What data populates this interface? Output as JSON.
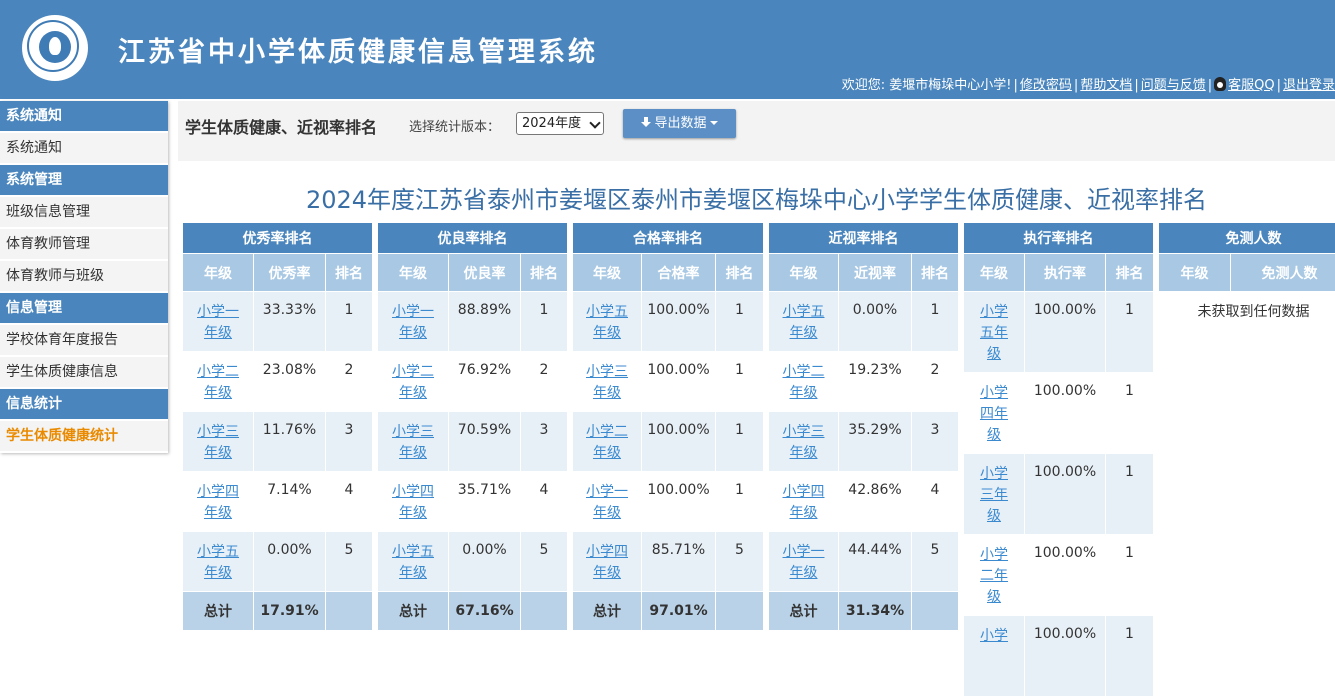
{
  "header": {
    "title": "江苏省中小学体质健康信息管理系统",
    "welcome": "欢迎您: 姜堰市梅垛中心小学!",
    "links": [
      "修改密码",
      "帮助文档",
      "问题与反馈",
      "客服QQ",
      "退出登录"
    ]
  },
  "sidebar": {
    "groups": [
      {
        "title": "系统通知",
        "items": [
          "系统通知"
        ]
      },
      {
        "title": "系统管理",
        "items": [
          "班级信息管理",
          "体育教师管理",
          "体育教师与班级"
        ]
      },
      {
        "title": "信息管理",
        "items": [
          "学校体育年度报告",
          "学生体质健康信息"
        ]
      },
      {
        "title": "信息统计",
        "items": [
          "学生体质健康统计"
        ]
      }
    ]
  },
  "toolbar": {
    "title": "学生体质健康、近视率排名",
    "version_label": "选择统计版本：",
    "version_value": "2024年度",
    "export_label": "导出数据"
  },
  "report_title": "2024年度江苏省泰州市姜堰区泰州市姜堰区梅垛中心小学学生体质健康、近视率排名",
  "tables": {
    "excellent": {
      "title": "优秀率排名",
      "columns": [
        "年级",
        "优秀率",
        "排名"
      ],
      "rows": [
        [
          "小学一年级",
          "33.33%",
          "1"
        ],
        [
          "小学二年级",
          "23.08%",
          "2"
        ],
        [
          "小学三年级",
          "11.76%",
          "3"
        ],
        [
          "小学四年级",
          "7.14%",
          "4"
        ],
        [
          "小学五年级",
          "0.00%",
          "5"
        ]
      ],
      "total_label": "总计",
      "total_value": "17.91%"
    },
    "good": {
      "title": "优良率排名",
      "columns": [
        "年级",
        "优良率",
        "排名"
      ],
      "rows": [
        [
          "小学一年级",
          "88.89%",
          "1"
        ],
        [
          "小学二年级",
          "76.92%",
          "2"
        ],
        [
          "小学三年级",
          "70.59%",
          "3"
        ],
        [
          "小学四年级",
          "35.71%",
          "4"
        ],
        [
          "小学五年级",
          "0.00%",
          "5"
        ]
      ],
      "total_label": "总计",
      "total_value": "67.16%"
    },
    "pass": {
      "title": "合格率排名",
      "columns": [
        "年级",
        "合格率",
        "排名"
      ],
      "rows": [
        [
          "小学五年级",
          "100.00%",
          "1"
        ],
        [
          "小学三年级",
          "100.00%",
          "1"
        ],
        [
          "小学二年级",
          "100.00%",
          "1"
        ],
        [
          "小学一年级",
          "100.00%",
          "1"
        ],
        [
          "小学四年级",
          "85.71%",
          "5"
        ]
      ],
      "total_label": "总计",
      "total_value": "97.01%"
    },
    "myopia": {
      "title": "近视率排名",
      "columns": [
        "年级",
        "近视率",
        "排名"
      ],
      "rows": [
        [
          "小学五年级",
          "0.00%",
          "1"
        ],
        [
          "小学二年级",
          "19.23%",
          "2"
        ],
        [
          "小学三年级",
          "35.29%",
          "3"
        ],
        [
          "小学四年级",
          "42.86%",
          "4"
        ],
        [
          "小学一年级",
          "44.44%",
          "5"
        ]
      ],
      "total_label": "总计",
      "total_value": "31.34%"
    },
    "execution": {
      "title": "执行率排名",
      "columns": [
        "年级",
        "执行率",
        "排名"
      ],
      "rows": [
        [
          "小学五年级",
          "100.00%",
          "1"
        ],
        [
          "小学四年级",
          "100.00%",
          "1"
        ],
        [
          "小学三年级",
          "100.00%",
          "1"
        ],
        [
          "小学二年级",
          "100.00%",
          "1"
        ],
        [
          "小学",
          "100.00%",
          "1"
        ]
      ]
    },
    "exempt": {
      "title": "免测人数",
      "columns": [
        "年级",
        "免测人数"
      ],
      "empty_text": "未获取到任何数据"
    }
  }
}
